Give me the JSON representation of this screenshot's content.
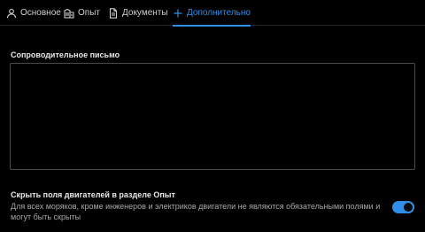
{
  "tabs": [
    {
      "label": "Основное",
      "icon": "user-icon",
      "active": false
    },
    {
      "label": "Опыт",
      "icon": "building-icon",
      "active": false
    },
    {
      "label": "Документы",
      "icon": "document-icon",
      "active": false
    },
    {
      "label": "Дополнительно",
      "icon": "plus-icon",
      "active": true
    }
  ],
  "cover_letter": {
    "label": "Сопроводительное письмо",
    "value": ""
  },
  "hide_engines": {
    "title": "Скрыть поля двигателей в разделе Опыт",
    "description": "Для всех моряков, кроме инженеров и электриков двигатели не являются обязательными полями и могут быть скрыты",
    "enabled": true
  },
  "colors": {
    "accent": "#2f8ee8",
    "background": "#000000"
  }
}
